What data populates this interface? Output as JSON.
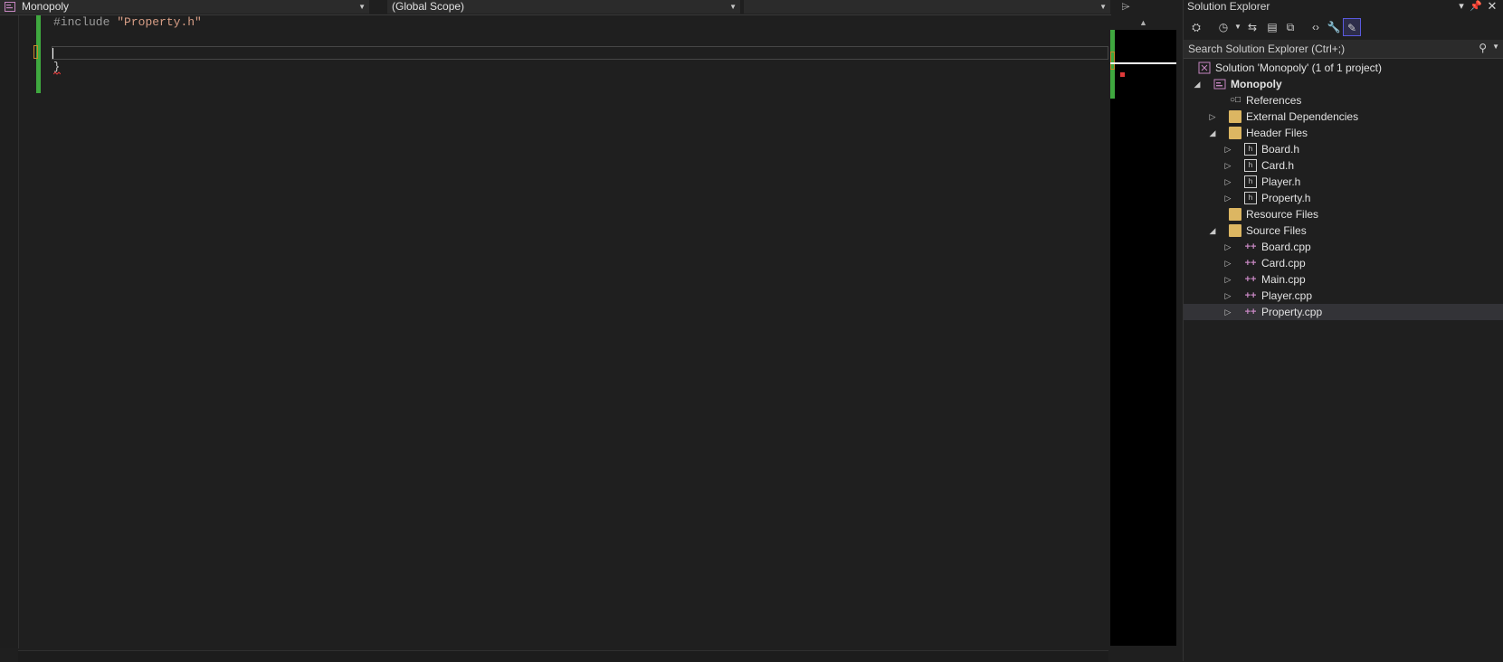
{
  "editor": {
    "project_dropdown": "Monopoly",
    "scope_dropdown": "(Global Scope)",
    "member_dropdown": "",
    "code": {
      "directive": "#include",
      "header": "\"Property.h\"",
      "closing_brace": "}"
    }
  },
  "solution_explorer": {
    "title": "Solution Explorer",
    "search_placeholder": "Search Solution Explorer (Ctrl+;)",
    "tree": {
      "solution": "Solution 'Monopoly' (1 of 1 project)",
      "project": "Monopoly",
      "references": "References",
      "external_dependencies": "External Dependencies",
      "header_files": "Header Files",
      "headers": [
        "Board.h",
        "Card.h",
        "Player.h",
        "Property.h"
      ],
      "resource_files": "Resource Files",
      "source_files": "Source Files",
      "sources": [
        "Board.cpp",
        "Card.cpp",
        "Main.cpp",
        "Player.cpp",
        "Property.cpp"
      ]
    },
    "selected_item": "Property.cpp"
  },
  "colors": {
    "change_bar": "#3fa83f",
    "string": "#d69d85",
    "error_marker": "#e03a3a",
    "cpp_icon": "#c586c0",
    "folder_icon": "#dcb662"
  }
}
